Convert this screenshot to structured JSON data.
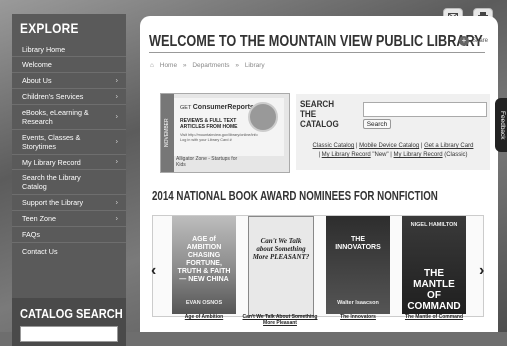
{
  "sidebar": {
    "title": "EXPLORE",
    "items": [
      {
        "label": "Library Home",
        "arrow": false
      },
      {
        "label": "Welcome",
        "arrow": false
      },
      {
        "label": "About Us",
        "arrow": true
      },
      {
        "label": "Children's Services",
        "arrow": true
      },
      {
        "label": "eBooks, eLearning & Research",
        "arrow": true
      },
      {
        "label": "Events, Classes & Storytimes",
        "arrow": true
      },
      {
        "label": "My Library Record",
        "arrow": true
      },
      {
        "label": "Search the Library Catalog",
        "arrow": false
      },
      {
        "label": "Support the Library",
        "arrow": true
      },
      {
        "label": "Teen Zone",
        "arrow": true
      },
      {
        "label": "FAQs",
        "arrow": false
      },
      {
        "label": "Contact Us",
        "arrow": false
      }
    ],
    "catalog_search": {
      "title": "CATALOG SEARCH"
    }
  },
  "header": {
    "title": "WELCOME TO THE MOUNTAIN VIEW PUBLIC LIBRARY",
    "share_label": "Share"
  },
  "breadcrumb": [
    "Home",
    "»",
    "Departments",
    "»",
    "Library"
  ],
  "promo": {
    "side_text": "NOVEMBER",
    "logo_line1": "GET",
    "logo_brand": "ConsumerReports",
    "reviews_line1": "REVIEWS & FULL TEXT",
    "reviews_line2": "ARTICLES FROM HOME",
    "url_line1": "Visit http://mountainview.gov/library/online/info",
    "url_line2": "Log in with your Library Card #",
    "caption_line1": "Alligator Zone - Startups for",
    "caption_line2": "Kids"
  },
  "search_catalog": {
    "title": "SEARCH THE CATALOG",
    "input_placeholder": "",
    "button_label": "Search",
    "links": {
      "classic": "Classic Catalog",
      "sep1": " | ",
      "mobile": "Mobile Device Catalog",
      "sep2": " | ",
      "get_card": "Get a Library Card",
      "sep3": " | ",
      "my_record": "My Library Record",
      "new_tag": " \"New\" ",
      "sep4": "| ",
      "my_record_classic": "My Library Record",
      "classic_suffix": " (Classic)"
    }
  },
  "books": {
    "heading": "2014 NATIONAL BOOK AWARD NOMINEES FOR NONFICTION",
    "items": [
      {
        "cover_title": "AGE of AMBITION CHASING FORTUNE, TRUTH & FAITH — NEW CHINA",
        "cover_author": "EVAN OSNOS",
        "caption": "Age of Ambition"
      },
      {
        "cover_title": "Can't We Talk about Something More PLEASANT?",
        "cover_author": "",
        "caption": "Can't We Talk About Something More Pleasant"
      },
      {
        "cover_title": "THE INNOVATORS",
        "cover_author": "Walter Isaacson",
        "caption": "The Innovators"
      },
      {
        "cover_title": "THE MANTLE OF COMMAND",
        "cover_author": "NIGEL HAMILTON",
        "caption": "The Mantle of Command"
      }
    ]
  },
  "feedback": {
    "label": "Feedback"
  },
  "colors": {
    "sidebar": "#5a5a5a",
    "main_bg": "#ffffff",
    "accent": "#333333"
  }
}
